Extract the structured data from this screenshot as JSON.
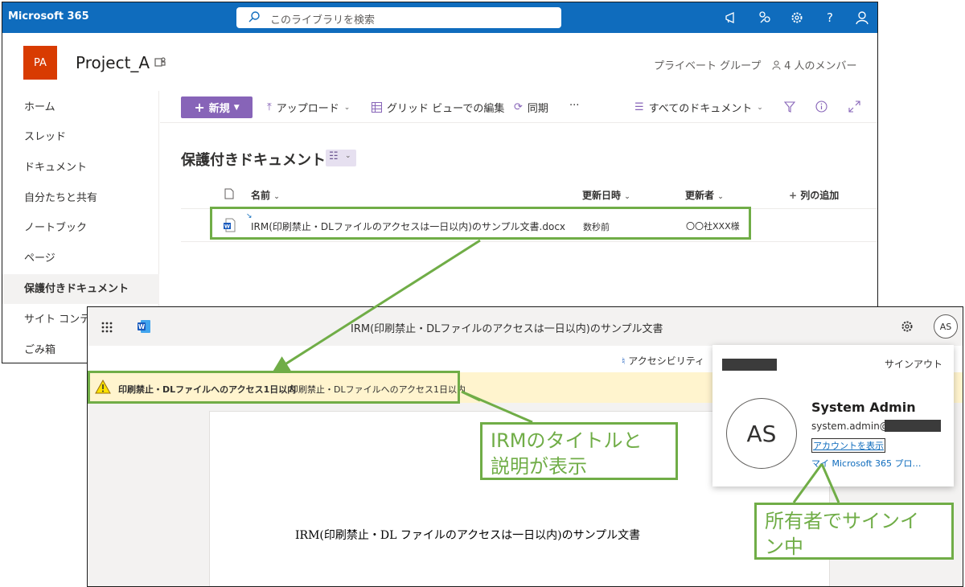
{
  "sharepoint": {
    "suite_title": "Microsoft 365",
    "search_placeholder": "このライブラリを検索",
    "site_initials": "PA",
    "site_title": "Project_A",
    "privacy": "プライベート グループ",
    "members": "4 人のメンバー",
    "nav": [
      "ホーム",
      "スレッド",
      "ドキュメント",
      "自分たちと共有",
      "ノートブック",
      "ページ",
      "保護付きドキュメント",
      "サイト コンテンツ",
      "ごみ箱"
    ],
    "selected_nav": "保護付きドキュメント",
    "commands": {
      "new": "新規",
      "upload": "アップロード",
      "grid_edit": "グリッド ビューでの編集",
      "sync": "同期",
      "more": "···",
      "view": "すべてのドキュメント"
    },
    "library_title": "保護付きドキュメント",
    "columns": {
      "name": "名前",
      "modified": "更新日時",
      "modified_by": "更新者",
      "add_column": "列の追加"
    },
    "files": [
      {
        "name": "IRM(印刷禁止・DLファイルのアクセスは一日以内)のサンプル文書.docx",
        "modified": "数秒前",
        "modified_by": "〇〇社XXX様"
      }
    ]
  },
  "word": {
    "title": "IRM(印刷禁止・DLファイルのアクセスは一日以内)のサンプル文書",
    "avatar": "AS",
    "accessibility": "アクセシビリティ",
    "irm_title": "印刷禁止・DLファイルへのアクセス1日以内",
    "irm_description": "印刷禁止・DLファイルへのアクセス1日以内",
    "doc_text": "IRM(印刷禁止・DL ファイルのアクセスは一日以内)のサンプル文書"
  },
  "account": {
    "signout": "サインアウト",
    "initials": "AS",
    "name": "System Admin",
    "email": "system.admin@",
    "view_account": "アカウントを表示",
    "profile": "マイ Microsoft 365 プロ…"
  },
  "callouts": {
    "irm": [
      "IRMのタイトルと",
      "説明が表示"
    ],
    "owner": [
      "所有者でサインイ",
      "ン中"
    ]
  },
  "colors": {
    "suite_bar": "#0f6cbd",
    "accent": "#8764b8",
    "callout": "#70ad47",
    "irm_bar": "#fff4ce",
    "site_logo": "#d83b01"
  }
}
